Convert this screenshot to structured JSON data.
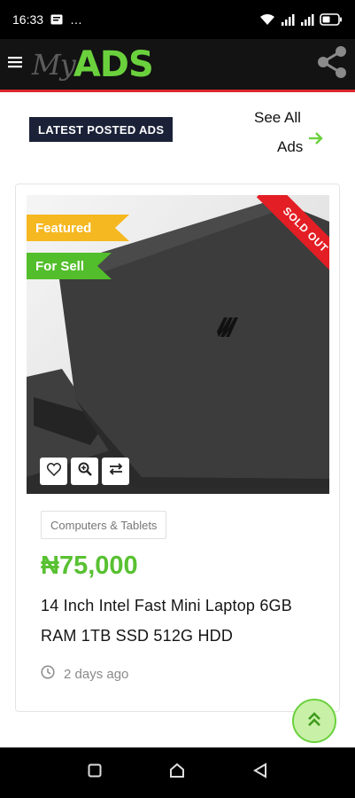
{
  "status_bar": {
    "time": "16:33",
    "dots": "…"
  },
  "header": {
    "logo_my": "My",
    "logo_ads": "ADS"
  },
  "section": {
    "badge": "LATEST POSTED ADS",
    "see_all_line1": "See All",
    "see_all_line2": "Ads"
  },
  "listing": {
    "ribbon_featured": "Featured",
    "ribbon_forsell": "For Sell",
    "sold_label": "SOLD OUT",
    "category": "Computers & Tablets",
    "price": "₦75,000",
    "title": "14 Inch Intel Fast Mini Laptop 6GB RAM 1TB SSD 512G HDD",
    "posted": "2 days ago"
  },
  "colors": {
    "accent_green": "#6ad13d",
    "header_red_line": "#d9272d",
    "badge_navy": "#1b2238",
    "featured_yellow": "#f5b820",
    "sold_red": "#e31e24"
  },
  "icons": {
    "menu": "hamburger-icon",
    "share": "share-icon",
    "arrow": "arrow-right-icon",
    "wishlist": "heart-icon",
    "quickview": "zoom-icon",
    "compare": "compare-icon",
    "clock": "clock-icon",
    "scroll_top": "double-chevron-up-icon"
  }
}
